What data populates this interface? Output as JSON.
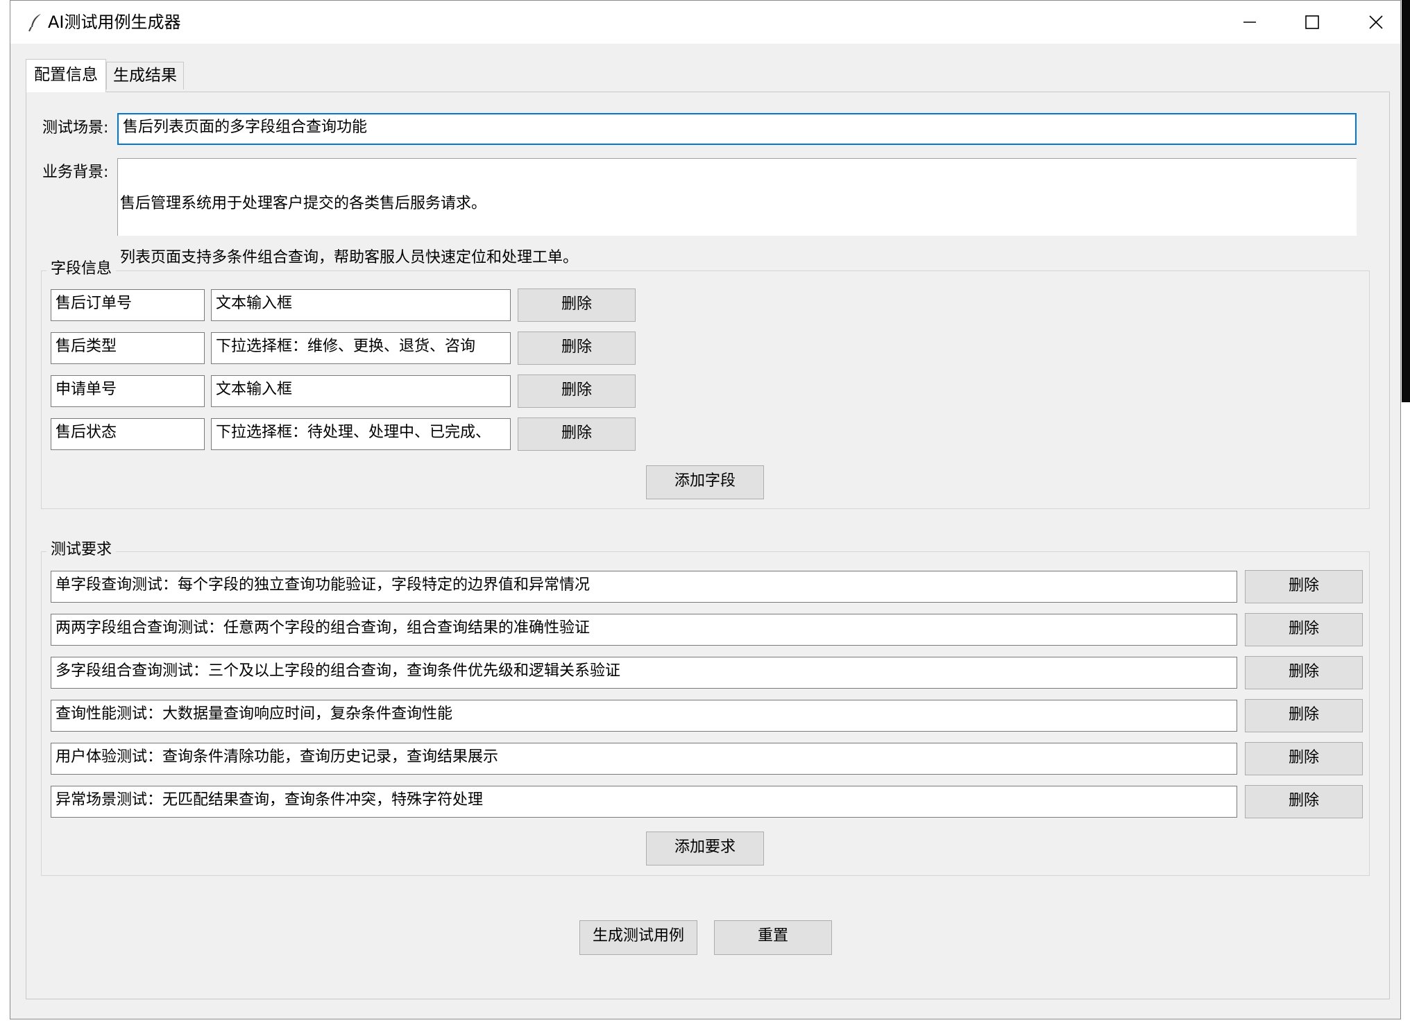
{
  "window": {
    "title": "AI测试用例生成器",
    "icon": "feather-icon"
  },
  "tabs": [
    {
      "label": "配置信息",
      "active": true
    },
    {
      "label": "生成结果",
      "active": false
    }
  ],
  "form": {
    "scenario_label": "测试场景:",
    "scenario_value": "售后列表页面的多字段组合查询功能",
    "background_label": "业务背景:",
    "background_line1": "售后管理系统用于处理客户提交的各类售后服务请求。",
    "background_line2": "列表页面支持多条件组合查询，帮助客服人员快速定位和处理工单。"
  },
  "fields_group": {
    "title": "字段信息",
    "rows": [
      {
        "name": "售后订单号",
        "type": "文本输入框",
        "delete_label": "删除"
      },
      {
        "name": "售后类型",
        "type": "下拉选择框：维修、更换、退货、咨询",
        "delete_label": "删除"
      },
      {
        "name": "申请单号",
        "type": "文本输入框",
        "delete_label": "删除"
      },
      {
        "name": "售后状态",
        "type": "下拉选择框：待处理、处理中、已完成、",
        "delete_label": "删除"
      }
    ],
    "add_label": "添加字段"
  },
  "requirements_group": {
    "title": "测试要求",
    "rows": [
      {
        "text": "单字段查询测试：每个字段的独立查询功能验证，字段特定的边界值和异常情况",
        "delete_label": "删除"
      },
      {
        "text": "两两字段组合查询测试：任意两个字段的组合查询，组合查询结果的准确性验证",
        "delete_label": "删除"
      },
      {
        "text": "多字段组合查询测试：三个及以上字段的组合查询，查询条件优先级和逻辑关系验证",
        "delete_label": "删除"
      },
      {
        "text": "查询性能测试：大数据量查询响应时间，复杂条件查询性能",
        "delete_label": "删除"
      },
      {
        "text": "用户体验测试：查询条件清除功能，查询历史记录，查询结果展示",
        "delete_label": "删除"
      },
      {
        "text": "异常场景测试：无匹配结果查询，查询条件冲突，特殊字符处理",
        "delete_label": "删除"
      }
    ],
    "add_label": "添加要求"
  },
  "actions": {
    "generate_label": "生成测试用例",
    "reset_label": "重置"
  },
  "colors": {
    "window_bg": "#f0f0f0",
    "button_bg": "#e1e1e1",
    "focus_border": "#0078d7"
  }
}
